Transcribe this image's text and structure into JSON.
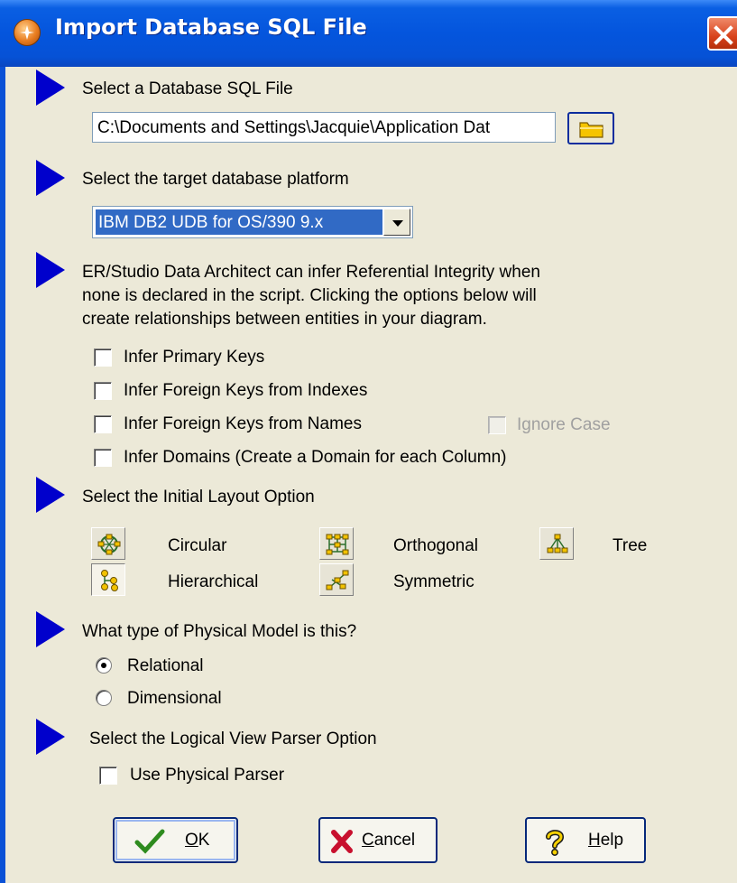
{
  "window": {
    "title": "Import Database SQL File"
  },
  "sections": {
    "sql_file": {
      "heading": "Select a Database SQL File",
      "path_value": "C:\\Documents and Settings\\Jacquie\\Application Dat"
    },
    "platform": {
      "heading": "Select the target database platform",
      "selected": "IBM DB2 UDB for OS/390 9.x"
    },
    "ri": {
      "description_lines": [
        "ER/Studio Data Architect can infer Referential Integrity when",
        "none is declared in the script. Clicking the options below will",
        "create relationships between entities in your diagram."
      ],
      "options": [
        {
          "label": "Infer Primary Keys",
          "checked": false
        },
        {
          "label": "Infer Foreign Keys from Indexes",
          "checked": false
        },
        {
          "label": "Infer Foreign Keys from Names",
          "checked": false
        },
        {
          "label": "Infer Domains (Create a Domain for each Column)",
          "checked": false
        }
      ],
      "ignore_case": {
        "label": "Ignore Case",
        "checked": false,
        "enabled": false
      }
    },
    "layout": {
      "heading": "Select the Initial Layout Option",
      "options": [
        {
          "label": "Circular",
          "icon": "circular-layout-icon",
          "selected": false
        },
        {
          "label": "Orthogonal",
          "icon": "orthogonal-layout-icon",
          "selected": false
        },
        {
          "label": "Tree",
          "icon": "tree-layout-icon",
          "selected": false
        },
        {
          "label": "Hierarchical",
          "icon": "hierarchical-layout-icon",
          "selected": true
        },
        {
          "label": "Symmetric",
          "icon": "symmetric-layout-icon",
          "selected": false
        }
      ]
    },
    "model": {
      "heading": "What type of Physical Model is this?",
      "options": [
        {
          "label": "Relational",
          "selected": true
        },
        {
          "label": "Dimensional",
          "selected": false
        }
      ]
    },
    "parser": {
      "heading": "Select the Logical View Parser Option",
      "use_physical": {
        "label": "Use Physical Parser",
        "checked": false
      }
    }
  },
  "buttons": {
    "ok": {
      "mnemonic": "O",
      "rest": "K"
    },
    "cancel": {
      "mnemonic": "C",
      "rest": "ancel"
    },
    "help": {
      "mnemonic": "H",
      "rest": "elp"
    }
  },
  "colors": {
    "titlebar": "#0455dd",
    "arrow": "#0000cc",
    "dialog_bg": "#ece9d8",
    "selection": "#316ac5"
  }
}
